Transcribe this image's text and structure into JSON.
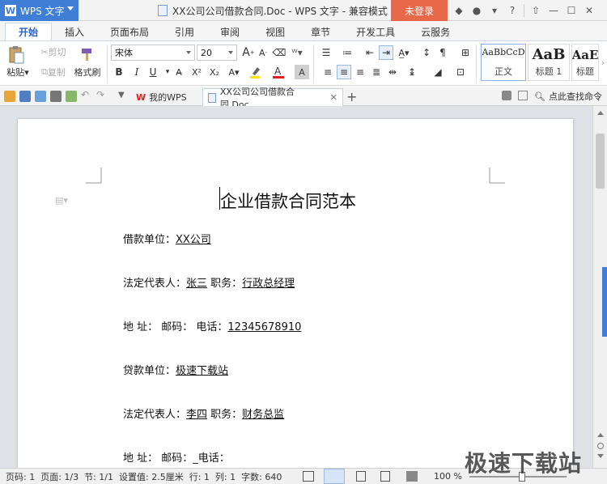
{
  "titlebar": {
    "app_label": "WPS 文字",
    "doc_title": "XX公司公司借款合同.Doc - WPS 文字 - 兼容模式",
    "login_label": "未登录"
  },
  "menu": {
    "tabs": [
      "开始",
      "插入",
      "页面布局",
      "引用",
      "审阅",
      "视图",
      "章节",
      "开发工具",
      "云服务"
    ],
    "active": "开始"
  },
  "ribbon": {
    "paste": "粘贴",
    "cut": "剪切",
    "copy": "复制",
    "format_painter": "格式刷",
    "font_name": "宋体",
    "font_size": "20",
    "styles": [
      {
        "sample": "AaBbCcD",
        "caption": "正文"
      },
      {
        "sample": "AaB",
        "caption": "标题 1"
      },
      {
        "sample": "AaE",
        "caption": "标题"
      }
    ]
  },
  "doc_tabs": {
    "home": "我的WPS",
    "current": "XX公司公司借款合同.Doc",
    "find": "点此查找命令"
  },
  "document": {
    "title": "企业借款合同范本",
    "lines": [
      {
        "label": "借款单位：",
        "value": "XX公司"
      },
      {
        "label": "法定代表人：",
        "value": "张三",
        "label2": " 职务：",
        "value2": "行政总经理"
      },
      {
        "label": "地 址：  邮码：  电话：",
        "value": "12345678910"
      },
      {
        "label": "贷款单位：",
        "value": "极速下载站"
      },
      {
        "label": "法定代表人：",
        "value": "李四",
        "label2": " 职务：",
        "value2": "财务总监"
      },
      {
        "label": "地 址：  邮码：_电话：",
        "value": ""
      }
    ]
  },
  "status": {
    "page_num": "页码: 1",
    "pages": "页面: 1/3",
    "section": "节: 1/1",
    "setting": "设置值: 2.5厘米",
    "row": "行: 1",
    "col": "列: 1",
    "chars": "字数: 640",
    "zoom": "100 %"
  },
  "watermark": "极速下载站"
}
